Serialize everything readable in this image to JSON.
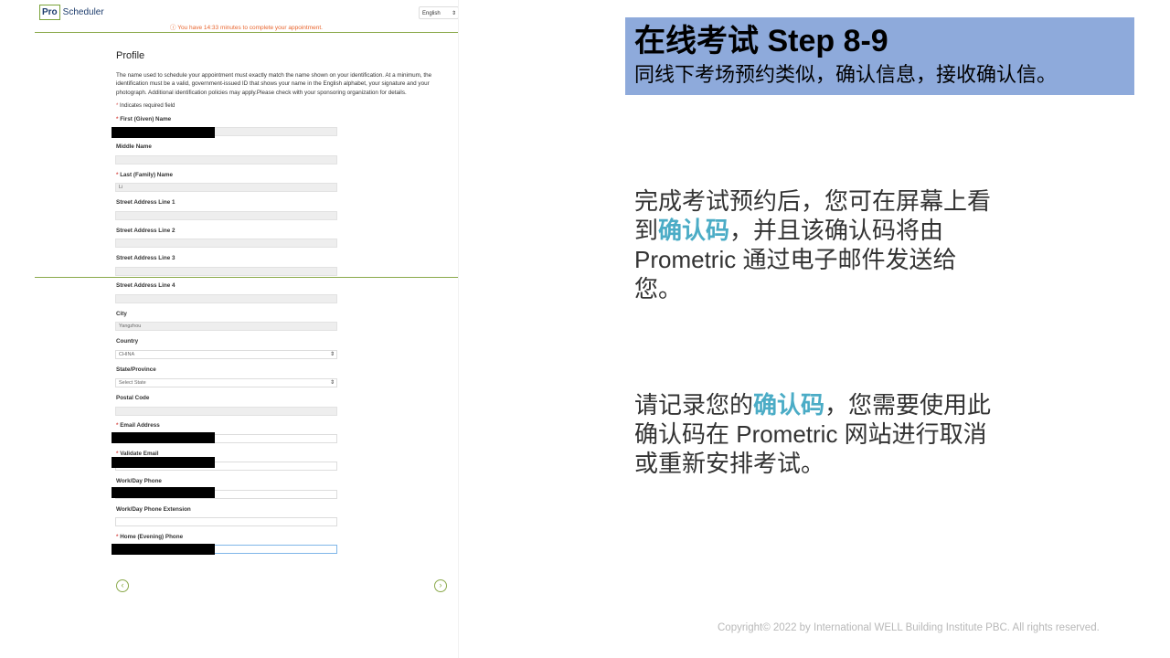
{
  "scheduler": {
    "logo_box": "Pro",
    "logo_text": "Scheduler",
    "language": "English",
    "timer": "ⓘ You have 14:33 minutes to complete your appointment.",
    "profile_title": "Profile",
    "intro": "The name used to schedule your appointment must exactly match the name shown on your identification. At a minimum, the identification must be a valid, government-issued ID that shows your name in the English alphabet, your signature and your photograph. Additional identification policies may apply.Please check with your sponsoring organization for details.",
    "required_note": "Indicates required field",
    "fields": {
      "first_name": {
        "label": "First (Given) Name",
        "value": ""
      },
      "middle_name": {
        "label": "Middle Name",
        "value": ""
      },
      "last_name": {
        "label": "Last (Family) Name",
        "value": "Li"
      },
      "street1": {
        "label": "Street Address Line 1",
        "value": ""
      },
      "street2": {
        "label": "Street Address Line 2",
        "value": ""
      },
      "street3": {
        "label": "Street Address Line 3",
        "value": ""
      },
      "street4": {
        "label": "Street Address Line 4",
        "value": ""
      },
      "city": {
        "label": "City",
        "value": "Yangzhou"
      },
      "country": {
        "label": "Country",
        "value": "CHINA"
      },
      "state": {
        "label": "State/Province",
        "value": "Select State"
      },
      "postal": {
        "label": "Postal Code",
        "value": ""
      },
      "email": {
        "label": "Email Address",
        "value": ""
      },
      "validate_email": {
        "label": "Validate Email",
        "value": ""
      },
      "work_phone": {
        "label": "Work/Day Phone",
        "value": ""
      },
      "work_ext": {
        "label": "Work/Day Phone Extension",
        "value": ""
      },
      "home_phone": {
        "label": "Home (Evening) Phone",
        "value": ""
      }
    },
    "prev_icon": "chevron-left-circle-icon",
    "next_icon": "chevron-right-circle-icon"
  },
  "slide": {
    "title": "在线考试 Step 8-9",
    "subtitle": "同线下考场预约类似，确认信息，接收确认信。",
    "para1_a": "完成考试预约后，您可在屏幕上看到",
    "para1_hl": "确认码",
    "para1_b": "，并且该确认码将由 Prometric 通过电子邮件发送给您。",
    "para2_a": "请记录您的",
    "para2_hl": "确认码",
    "para2_b": "，您需要使用此确认码在 Prometric 网站进行取消或重新安排考试。",
    "copyright": "Copyright© 2022 by International WELL Building Institute PBC. All rights reserved.",
    "highlight_color": "#4bacc6",
    "banner_color": "#8eaadb"
  }
}
